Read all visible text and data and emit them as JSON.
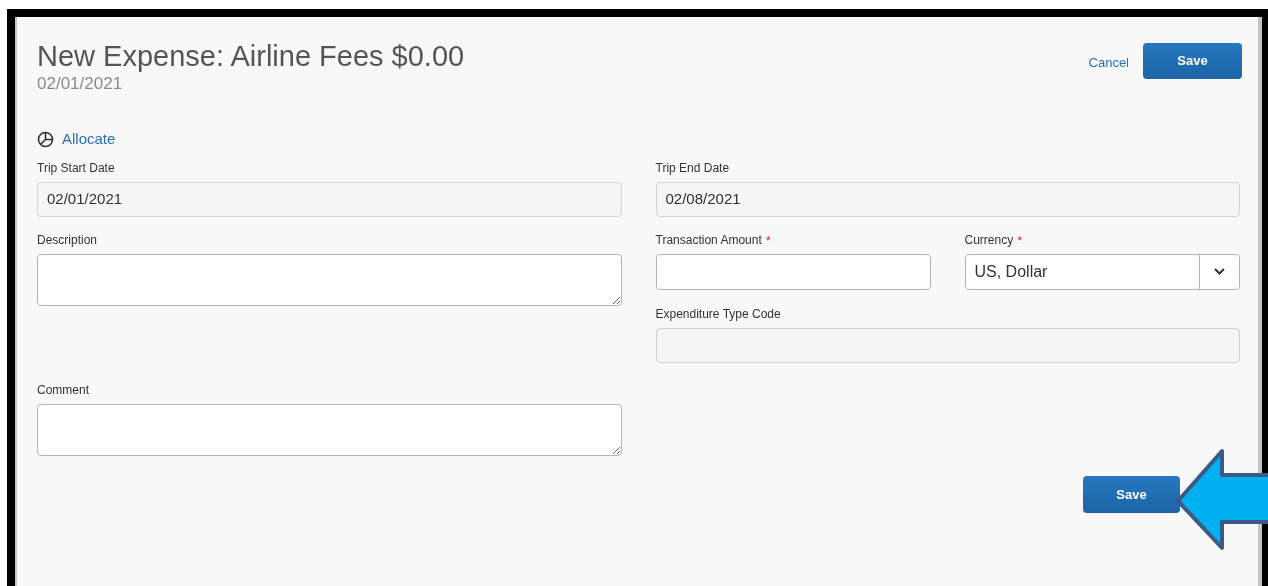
{
  "header": {
    "title": "New Expense: Airline Fees $0.00",
    "date": "02/01/2021",
    "cancel": "Cancel",
    "save": "Save"
  },
  "allocate": {
    "label": "Allocate"
  },
  "left_column": [
    {
      "kind": "readonly",
      "label": "Trip Start Date",
      "value": "02/01/2021"
    },
    {
      "kind": "textarea",
      "label": "Description"
    },
    {
      "kind": "textarea",
      "label": "Comment"
    }
  ],
  "right_column": [
    {
      "kind": "readonly",
      "label": "Trip End Date",
      "value": "02/08/2021"
    },
    {
      "kind": "text",
      "label": "Transaction Amount",
      "required_mark": "*"
    },
    {
      "kind": "select",
      "label": "Currency",
      "value": "US, Dollar",
      "required_mark": "*"
    },
    {
      "kind": "readonly",
      "label": "Expenditure Type Code"
    }
  ],
  "footer": {
    "save": "Save"
  }
}
